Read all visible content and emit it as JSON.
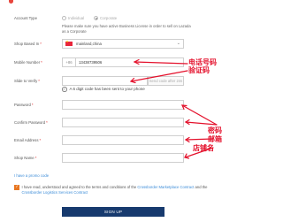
{
  "form": {
    "account_type_label": "Account Type",
    "account_type_options": [
      "Individual",
      "Corporate"
    ],
    "account_type_note": "Please make sure you have active Business License in order to sell on Lazada as a Corporate",
    "ship_based_label": "Shop Based In",
    "ship_based_value": "mainland,china",
    "mobile_label": "Mobile Number",
    "phone_prefix": "+86",
    "phone_value": "13438739506",
    "verify_label": "Slide to Verify",
    "verify_button": "Send code after 24s",
    "code_sent_msg": "A 6 digit code has been sent to your phone",
    "password_label": "Password",
    "confirm_password_label": "Confirm Password",
    "email_label": "Email Address",
    "shop_name_label": "Shop Name",
    "required_mark": "*",
    "promo_link": "I have a promo code",
    "agree_text_prefix": "I have read, understood and agreed to the terms and conditions of the",
    "agree_link_1": "Crossborder Marketplace Contract",
    "agree_text_mid": "and the",
    "agree_link_2": "Crossborder Logistics Services Contract",
    "signup_button": "SIGN UP"
  },
  "annotations": {
    "phone": "电话号码",
    "verify": "验证码",
    "password": "密码",
    "email": "邮箱",
    "shop_name": "店铺名"
  },
  "icons": {
    "flag": "china-flag-icon",
    "chevron": "chevron-down-icon",
    "check": "check-circle-icon"
  },
  "colors": {
    "annotation_red": "#e4102b",
    "signup_bg": "#173a6e",
    "link_blue": "#3c8cd8",
    "checkbox_orange": "#e87722"
  }
}
